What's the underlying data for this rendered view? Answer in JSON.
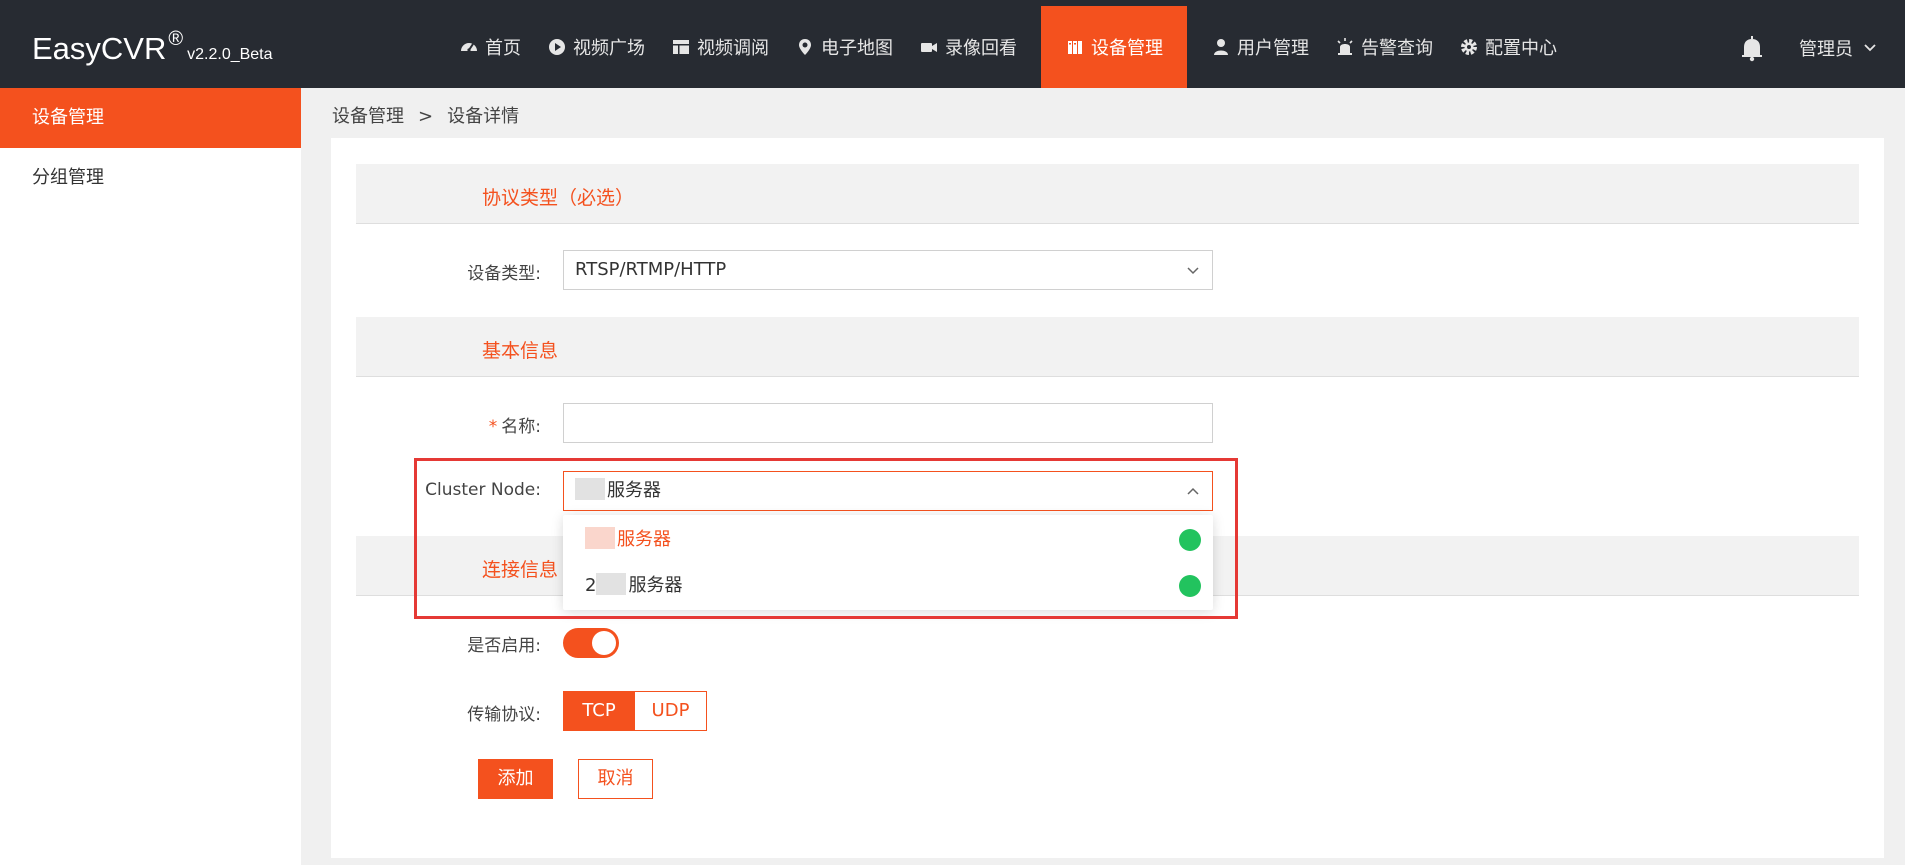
{
  "app": {
    "brand": "EasyCVR",
    "registered": "®",
    "version": "v2.2.0_Beta"
  },
  "nav": {
    "items": [
      {
        "label": "首页",
        "icon": "dashboard-icon"
      },
      {
        "label": "视频广场",
        "icon": "play-circle-icon"
      },
      {
        "label": "视频调阅",
        "icon": "grid-layout-icon"
      },
      {
        "label": "电子地图",
        "icon": "map-pin-icon"
      },
      {
        "label": "录像回看",
        "icon": "video-camera-icon"
      },
      {
        "label": "设备管理",
        "icon": "device-icon",
        "active": true
      },
      {
        "label": "用户管理",
        "icon": "user-icon"
      },
      {
        "label": "告警查询",
        "icon": "alarm-icon"
      },
      {
        "label": "配置中心",
        "icon": "gear-icon"
      }
    ],
    "user_label": "管理员"
  },
  "sidebar": {
    "items": [
      {
        "label": "设备管理",
        "active": true
      },
      {
        "label": "分组管理"
      }
    ]
  },
  "breadcrumb": {
    "parent": "设备管理",
    "separator": ">",
    "current": "设备详情"
  },
  "form": {
    "protocol_section": "协议类型（必选）",
    "device_type_label": "设备类型:",
    "device_type_value": "RTSP/RTMP/HTTP",
    "basic_section": "基本信息",
    "required_mark": "*",
    "name_label": "名称:",
    "name_value": "",
    "cluster_label": "Cluster Node:",
    "cluster_value": "服务器",
    "cluster_options": [
      {
        "label": "服务器",
        "status": "online",
        "selected": true
      },
      {
        "label": "服务器",
        "prefix": "2",
        "status": "online"
      }
    ],
    "connection_section": "连接信息",
    "enabled_label": "是否启用:",
    "enabled": true,
    "transport_label": "传输协议:",
    "transport_options": [
      "TCP",
      "UDP"
    ],
    "transport_selected": "TCP",
    "submit_label": "添加",
    "cancel_label": "取消"
  },
  "colors": {
    "accent": "#f4511e",
    "navbar": "#272b32",
    "online": "#22c35e",
    "highlight": "#e53935"
  }
}
